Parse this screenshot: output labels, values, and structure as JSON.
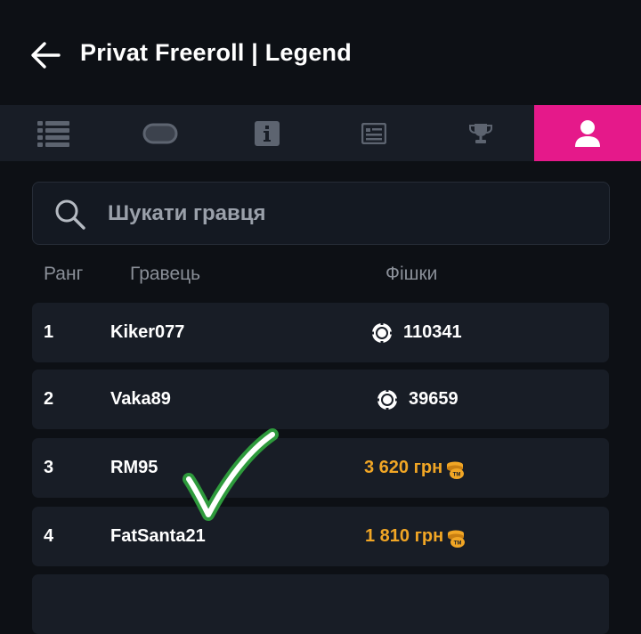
{
  "header": {
    "title": "Privat Freeroll | Legend"
  },
  "tabs": [
    {
      "icon": "list-icon",
      "active": false
    },
    {
      "icon": "table-icon",
      "active": false
    },
    {
      "icon": "info-icon",
      "active": false
    },
    {
      "icon": "id-card-icon",
      "active": false
    },
    {
      "icon": "trophy-icon",
      "active": false
    },
    {
      "icon": "user-icon",
      "active": true
    }
  ],
  "search": {
    "placeholder": "Шукати гравця"
  },
  "columns": {
    "rank": "Ранг",
    "player": "Гравець",
    "chips": "Фішки"
  },
  "rows": [
    {
      "rank": "1",
      "player": "Kiker077",
      "chips": "110341"
    },
    {
      "rank": "2",
      "player": "Vaka89",
      "chips": "39659"
    },
    {
      "rank": "3",
      "player": "RM95",
      "prize": "3 620 грн"
    },
    {
      "rank": "4",
      "player": "FatSanta21",
      "prize": "1 810 грн"
    }
  ],
  "colors": {
    "accent": "#e5198a",
    "prize": "#f1a625",
    "checkmark": "#2e9a3c"
  }
}
